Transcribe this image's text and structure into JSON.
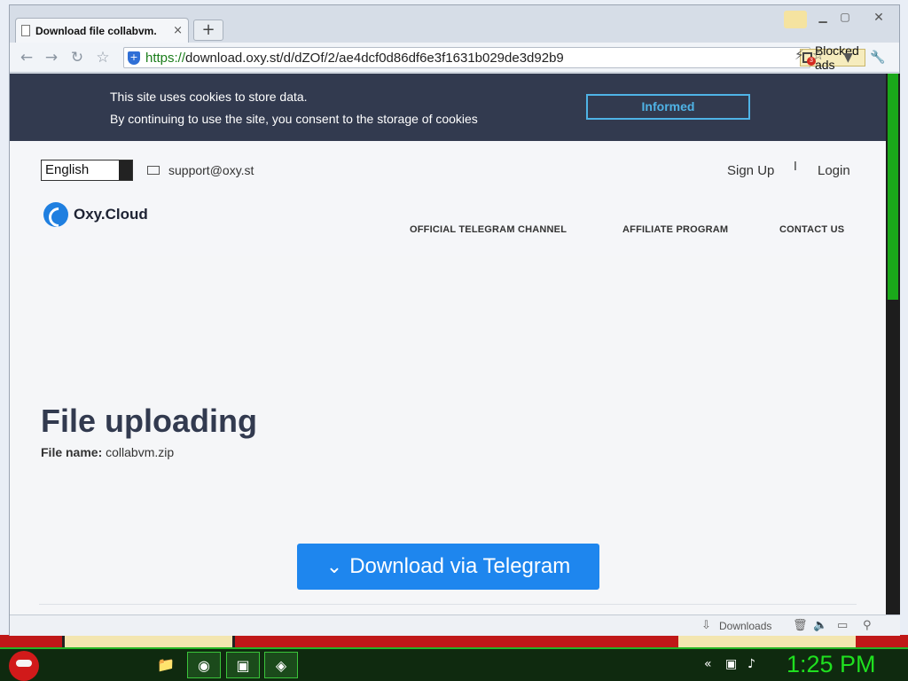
{
  "browser": {
    "tab_title": "Download file collabvm.",
    "tab_close": "×",
    "new_tab": "+",
    "url_scheme": "https://",
    "url_rest": "download.oxy.st/d/dZOf/2/ae4dcf0d86df6e3f1631b029de3d92b9",
    "blocked_ads_label": "Blocked ads",
    "blocked_ads_count": "3",
    "downloads_label": "Downloads"
  },
  "cookie_banner": {
    "line1": "This site uses cookies to store data.",
    "line2": "By continuing to use the site, you consent to the storage of cookies",
    "button": "Informed"
  },
  "header": {
    "language": "English",
    "email": "support@oxy.st",
    "signup": "Sign Up",
    "separator": "I",
    "login": "Login",
    "logo_text": "Oxy.Cloud",
    "nav": [
      "OFFICIAL TELEGRAM CHANNEL",
      "AFFILIATE PROGRAM",
      "CONTACT US"
    ]
  },
  "main": {
    "title": "File uploading",
    "file_name_label": "File name:",
    "file_name": "collabvm.zip",
    "download_button": "Download via Telegram"
  },
  "taskbar": {
    "clock": "1:25 PM"
  },
  "colors": {
    "banner_bg": "#323a4f",
    "accent_blue": "#1e86ee",
    "informed_border": "#4fb3e6",
    "taskbar_green": "#1fe01f"
  }
}
